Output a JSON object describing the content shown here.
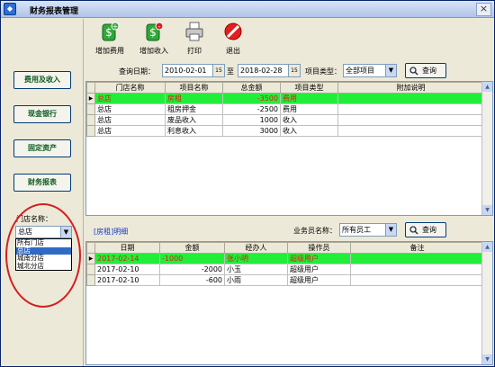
{
  "window": {
    "title": "财务报表管理",
    "close_glyph": "×"
  },
  "sidebar": {
    "buttons": [
      "费用及收入",
      "现金银行",
      "固定资产",
      "财务报表"
    ],
    "store_label": "门店名称：",
    "store_selected": "总店",
    "store_options": [
      "所有门店",
      "总店",
      "城南分店",
      "城北分店"
    ]
  },
  "toolbar": {
    "buttons": [
      {
        "label": "增加费用",
        "icon": "money-add-icon"
      },
      {
        "label": "增加收入",
        "icon": "money-remove-icon"
      },
      {
        "label": "打印",
        "icon": "printer-icon"
      },
      {
        "label": "退出",
        "icon": "exit-icon"
      }
    ]
  },
  "filter": {
    "date_label": "查询日期：",
    "date_from": "2010-02-01",
    "to_label": "至",
    "date_to": "2018-02-28",
    "type_label": "项目类型：",
    "type_value": "全部项目",
    "query_label": "查询"
  },
  "top_table": {
    "columns": [
      "门店名称",
      "项目名称",
      "总金额",
      "项目类型",
      "附加说明"
    ],
    "rows": [
      [
        "总店",
        "房租",
        "-3500",
        "费用",
        ""
      ],
      [
        "总店",
        "租房押金",
        "-2500",
        "费用",
        ""
      ],
      [
        "总店",
        "废品收入",
        "1000",
        "收入",
        ""
      ],
      [
        "总店",
        "利息收入",
        "3000",
        "收入",
        ""
      ]
    ]
  },
  "detail": {
    "title": "[房租]明细",
    "salesman_label": "业务员名称：",
    "salesman_value": "所有员工",
    "query_label": "查询"
  },
  "bottom_table": {
    "columns": [
      "日期",
      "金额",
      "经办人",
      "操作员",
      "备注"
    ],
    "rows": [
      [
        "2017-02-14",
        "-1000",
        "张小明",
        "超级用户",
        ""
      ],
      [
        "2017-02-10",
        "-2000",
        "小玉",
        "超级用户",
        ""
      ],
      [
        "2017-02-10",
        "-600",
        "小雨",
        "超级用户",
        ""
      ]
    ]
  },
  "colors": {
    "highlight_row": "#22ee3a",
    "highlight_text": "#d82010",
    "sidebar_text": "#0a5a1e",
    "annotation_circle": "#d42020"
  }
}
